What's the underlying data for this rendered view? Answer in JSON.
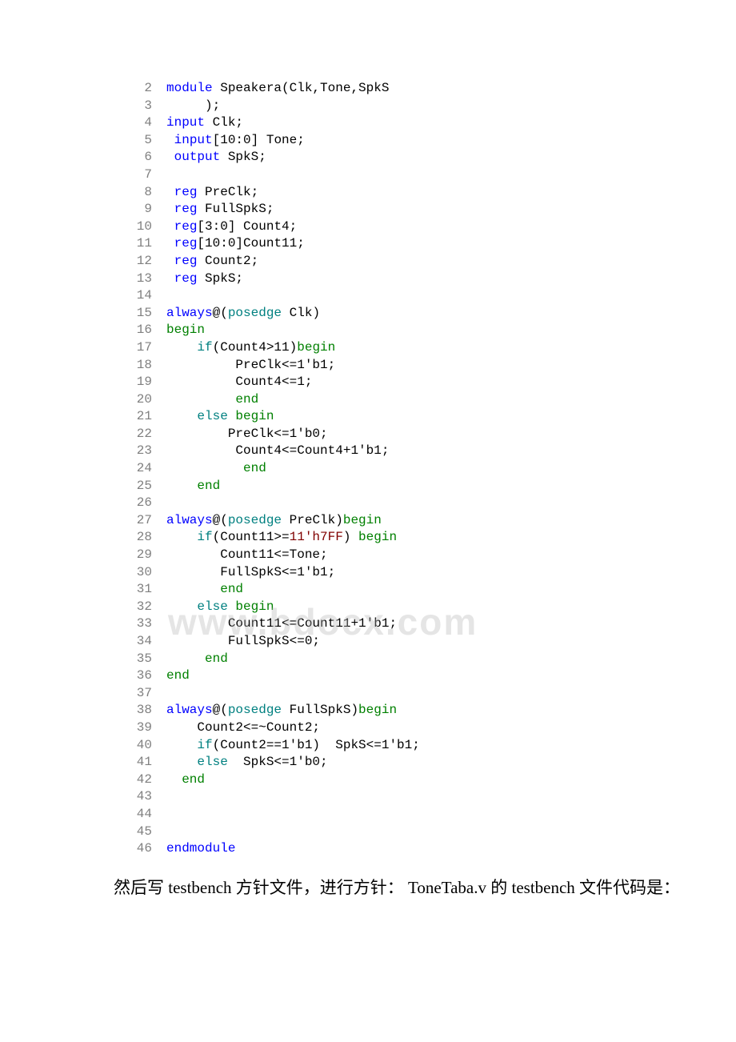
{
  "code_lines": [
    {
      "num": 2,
      "indent": 0,
      "tokens": [
        {
          "t": "module",
          "c": "kw-blue"
        },
        {
          "t": " Speakera(Clk,Tone,SpkS",
          "c": ""
        }
      ]
    },
    {
      "num": 3,
      "indent": 0,
      "tokens": [
        {
          "t": "     );",
          "c": ""
        }
      ]
    },
    {
      "num": 4,
      "indent": 0,
      "tokens": [
        {
          "t": "input",
          "c": "kw-blue"
        },
        {
          "t": " Clk;",
          "c": ""
        }
      ]
    },
    {
      "num": 5,
      "indent": 0,
      "tokens": [
        {
          "t": " ",
          "c": ""
        },
        {
          "t": "input",
          "c": "kw-blue"
        },
        {
          "t": "[10:0] Tone;",
          "c": ""
        }
      ]
    },
    {
      "num": 6,
      "indent": 0,
      "tokens": [
        {
          "t": " ",
          "c": ""
        },
        {
          "t": "output",
          "c": "kw-blue"
        },
        {
          "t": " SpkS;",
          "c": ""
        }
      ]
    },
    {
      "num": 7,
      "indent": 0,
      "tokens": []
    },
    {
      "num": 8,
      "indent": 0,
      "tokens": [
        {
          "t": " ",
          "c": ""
        },
        {
          "t": "reg",
          "c": "kw-blue"
        },
        {
          "t": " PreClk;",
          "c": ""
        }
      ]
    },
    {
      "num": 9,
      "indent": 0,
      "tokens": [
        {
          "t": " ",
          "c": ""
        },
        {
          "t": "reg",
          "c": "kw-blue"
        },
        {
          "t": " FullSpkS;",
          "c": ""
        }
      ]
    },
    {
      "num": 10,
      "indent": 0,
      "tokens": [
        {
          "t": " ",
          "c": ""
        },
        {
          "t": "reg",
          "c": "kw-blue"
        },
        {
          "t": "[3:0] Count4;",
          "c": ""
        }
      ]
    },
    {
      "num": 11,
      "indent": 0,
      "tokens": [
        {
          "t": " ",
          "c": ""
        },
        {
          "t": "reg",
          "c": "kw-blue"
        },
        {
          "t": "[10:0]Count11;",
          "c": ""
        }
      ]
    },
    {
      "num": 12,
      "indent": 0,
      "tokens": [
        {
          "t": " ",
          "c": ""
        },
        {
          "t": "reg",
          "c": "kw-blue"
        },
        {
          "t": " Count2;",
          "c": ""
        }
      ]
    },
    {
      "num": 13,
      "indent": 0,
      "tokens": [
        {
          "t": " ",
          "c": ""
        },
        {
          "t": "reg",
          "c": "kw-blue"
        },
        {
          "t": " SpkS;",
          "c": ""
        }
      ]
    },
    {
      "num": 14,
      "indent": 0,
      "tokens": []
    },
    {
      "num": 15,
      "indent": 0,
      "tokens": [
        {
          "t": "always",
          "c": "kw-blue"
        },
        {
          "t": "@(",
          "c": ""
        },
        {
          "t": "posedge",
          "c": "kw-teal"
        },
        {
          "t": " Clk)",
          "c": ""
        }
      ]
    },
    {
      "num": 16,
      "indent": 0,
      "tokens": [
        {
          "t": "begin",
          "c": "kw-green"
        }
      ]
    },
    {
      "num": 17,
      "indent": 0,
      "tokens": [
        {
          "t": "    ",
          "c": ""
        },
        {
          "t": "if",
          "c": "kw-teal"
        },
        {
          "t": "(Count4>11)",
          "c": ""
        },
        {
          "t": "begin",
          "c": "kw-green"
        }
      ]
    },
    {
      "num": 18,
      "indent": 0,
      "tokens": [
        {
          "t": "         PreClk<=1'b1;",
          "c": ""
        }
      ]
    },
    {
      "num": 19,
      "indent": 0,
      "tokens": [
        {
          "t": "         Count4<=1;",
          "c": ""
        }
      ]
    },
    {
      "num": 20,
      "indent": 0,
      "tokens": [
        {
          "t": "         ",
          "c": ""
        },
        {
          "t": "end",
          "c": "kw-green"
        }
      ]
    },
    {
      "num": 21,
      "indent": 0,
      "tokens": [
        {
          "t": "    ",
          "c": ""
        },
        {
          "t": "else",
          "c": "kw-teal"
        },
        {
          "t": " ",
          "c": ""
        },
        {
          "t": "begin",
          "c": "kw-green"
        }
      ]
    },
    {
      "num": 22,
      "indent": 0,
      "tokens": [
        {
          "t": "        PreClk<=1'b0;",
          "c": ""
        }
      ]
    },
    {
      "num": 23,
      "indent": 0,
      "tokens": [
        {
          "t": "         Count4<=Count4+1'b1;",
          "c": ""
        }
      ]
    },
    {
      "num": 24,
      "indent": 0,
      "tokens": [
        {
          "t": "          ",
          "c": ""
        },
        {
          "t": "end",
          "c": "kw-green"
        }
      ]
    },
    {
      "num": 25,
      "indent": 0,
      "tokens": [
        {
          "t": "    ",
          "c": ""
        },
        {
          "t": "end",
          "c": "kw-green"
        }
      ]
    },
    {
      "num": 26,
      "indent": 0,
      "tokens": []
    },
    {
      "num": 27,
      "indent": 0,
      "tokens": [
        {
          "t": "always",
          "c": "kw-blue"
        },
        {
          "t": "@(",
          "c": ""
        },
        {
          "t": "posedge",
          "c": "kw-teal"
        },
        {
          "t": " PreClk)",
          "c": ""
        },
        {
          "t": "begin",
          "c": "kw-green"
        }
      ]
    },
    {
      "num": 28,
      "indent": 0,
      "tokens": [
        {
          "t": "    ",
          "c": ""
        },
        {
          "t": "if",
          "c": "kw-teal"
        },
        {
          "t": "(Count11>=",
          "c": ""
        },
        {
          "t": "11'h7FF",
          "c": "kw-red"
        },
        {
          "t": ") ",
          "c": ""
        },
        {
          "t": "begin",
          "c": "kw-green"
        }
      ]
    },
    {
      "num": 29,
      "indent": 0,
      "tokens": [
        {
          "t": "       Count11<=Tone;",
          "c": ""
        }
      ]
    },
    {
      "num": 30,
      "indent": 0,
      "tokens": [
        {
          "t": "       FullSpkS<=1'b1;",
          "c": ""
        }
      ]
    },
    {
      "num": 31,
      "indent": 0,
      "tokens": [
        {
          "t": "       ",
          "c": ""
        },
        {
          "t": "end",
          "c": "kw-green"
        }
      ]
    },
    {
      "num": 32,
      "indent": 0,
      "tokens": [
        {
          "t": "    ",
          "c": ""
        },
        {
          "t": "else",
          "c": "kw-teal"
        },
        {
          "t": " ",
          "c": ""
        },
        {
          "t": "begin",
          "c": "kw-green"
        }
      ]
    },
    {
      "num": 33,
      "indent": 0,
      "tokens": [
        {
          "t": "        Count11<=Count11+1'b1;",
          "c": ""
        }
      ]
    },
    {
      "num": 34,
      "indent": 0,
      "tokens": [
        {
          "t": "        FullSpkS<=0;",
          "c": ""
        }
      ]
    },
    {
      "num": 35,
      "indent": 0,
      "tokens": [
        {
          "t": "     ",
          "c": ""
        },
        {
          "t": "end",
          "c": "kw-green"
        }
      ]
    },
    {
      "num": 36,
      "indent": 0,
      "tokens": [
        {
          "t": "end",
          "c": "kw-green"
        }
      ]
    },
    {
      "num": 37,
      "indent": 0,
      "tokens": []
    },
    {
      "num": 38,
      "indent": 0,
      "tokens": [
        {
          "t": "always",
          "c": "kw-blue"
        },
        {
          "t": "@(",
          "c": ""
        },
        {
          "t": "posedge",
          "c": "kw-teal"
        },
        {
          "t": " FullSpkS)",
          "c": ""
        },
        {
          "t": "begin",
          "c": "kw-green"
        }
      ]
    },
    {
      "num": 39,
      "indent": 0,
      "tokens": [
        {
          "t": "    Count2<=~Count2;",
          "c": ""
        }
      ]
    },
    {
      "num": 40,
      "indent": 0,
      "tokens": [
        {
          "t": "    ",
          "c": ""
        },
        {
          "t": "if",
          "c": "kw-teal"
        },
        {
          "t": "(Count2==1'b1)  SpkS<=1'b1;",
          "c": ""
        }
      ]
    },
    {
      "num": 41,
      "indent": 0,
      "tokens": [
        {
          "t": "    ",
          "c": ""
        },
        {
          "t": "else",
          "c": "kw-teal"
        },
        {
          "t": "  SpkS<=1'b0;",
          "c": ""
        }
      ]
    },
    {
      "num": 42,
      "indent": 0,
      "tokens": [
        {
          "t": "  ",
          "c": ""
        },
        {
          "t": "end",
          "c": "kw-green"
        }
      ]
    },
    {
      "num": 43,
      "indent": 0,
      "tokens": []
    },
    {
      "num": 44,
      "indent": 0,
      "tokens": []
    },
    {
      "num": 45,
      "indent": 0,
      "tokens": []
    },
    {
      "num": 46,
      "indent": 0,
      "tokens": [
        {
          "t": "endmodule",
          "c": "kw-blue"
        }
      ]
    }
  ],
  "watermark": "www.bdocx.com",
  "chinese_text": "然后写 testbench 方针文件，进行方针： ToneTaba.v 的 testbench 文件代码是："
}
